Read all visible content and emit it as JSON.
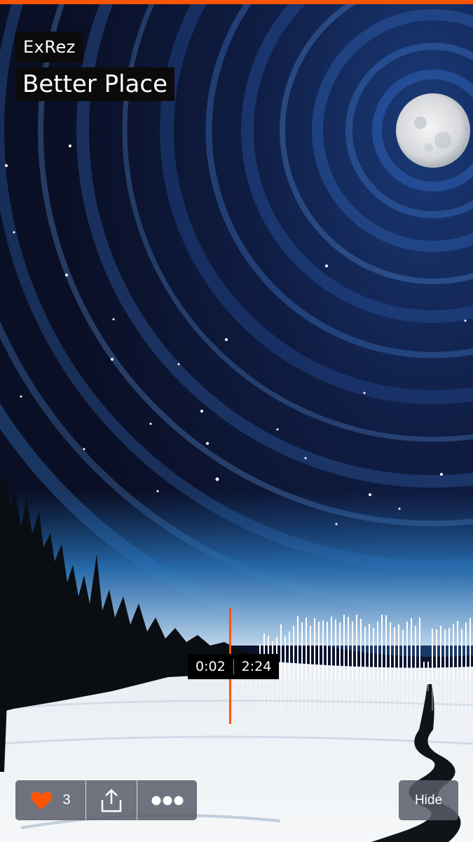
{
  "theme": {
    "accent": "#ff5500",
    "label_bg": "#0b0b0b",
    "button_bg": "#585c68"
  },
  "track": {
    "artist": "ExRez",
    "title": "Better Place"
  },
  "player": {
    "elapsed": "0:02",
    "duration": "2:24",
    "progress_fraction": 0.014
  },
  "actions": {
    "like": {
      "icon": "heart-icon",
      "count": "3"
    },
    "share": {
      "icon": "share-icon"
    },
    "more": {
      "icon": "more-dots-icon"
    },
    "hide_label": "Hide"
  },
  "artwork": {
    "description_icon": "night-sky-moon-artwork"
  }
}
